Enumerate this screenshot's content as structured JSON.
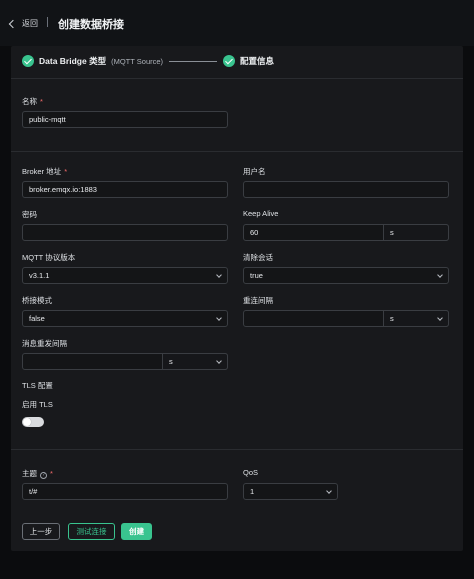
{
  "header": {
    "back_label": "返回",
    "title": "创建数据桥接"
  },
  "steps": {
    "step1_label": "Data Bridge 类型",
    "step1_sub": "(MQTT Source)",
    "step2_label": "配置信息"
  },
  "form": {
    "name_label": "名称",
    "name_value": "public-mqtt",
    "broker_label": "Broker 地址",
    "broker_value": "broker.emqx.io:1883",
    "username_label": "用户名",
    "username_value": "",
    "password_label": "密码",
    "password_value": "",
    "keepalive_label": "Keep Alive",
    "keepalive_value": "60",
    "keepalive_unit": "s",
    "mqtt_version_label": "MQTT 协议版本",
    "mqtt_version_value": "v3.1.1",
    "clean_session_label": "清除会话",
    "clean_session_value": "true",
    "bridge_mode_label": "桥接模式",
    "bridge_mode_value": "false",
    "reconnect_label": "重连间隔",
    "reconnect_value": "",
    "reconnect_unit": "s",
    "retry_label": "消息重发间隔",
    "retry_value": "",
    "retry_unit": "s",
    "tls_section_label": "TLS 配置",
    "enable_tls_label": "启用 TLS",
    "enable_tls_on": false,
    "topic_label": "主题",
    "topic_value": "t/#",
    "qos_label": "QoS",
    "qos_value": "1",
    "required_mark": "*",
    "info_icon": "?"
  },
  "buttons": {
    "prev": "上一步",
    "test": "测试连接",
    "create": "创建"
  },
  "colors": {
    "accent": "#39c48f",
    "required": "#f56c6c",
    "panel": "#18191c"
  }
}
